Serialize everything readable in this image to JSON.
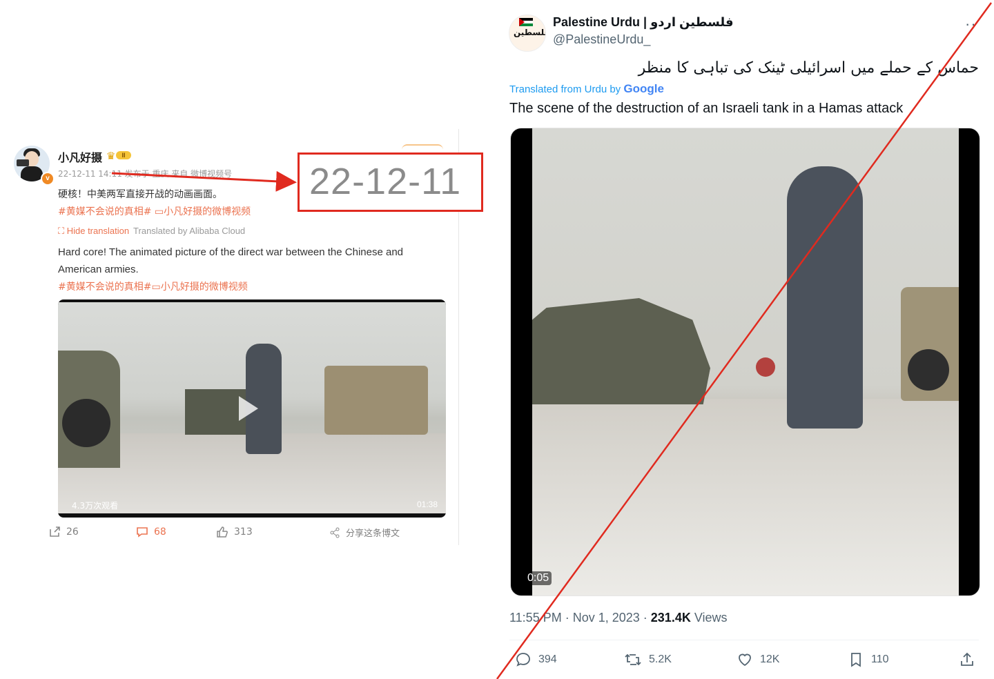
{
  "weibo": {
    "username": "小凡好摄",
    "level_badge": "II",
    "meta": "22-12-11 14:11 发布于 重庆 来自 微博视频号",
    "text": "硬核！中美两军直接开战的动画画面。",
    "tags": "#黄媒不会说的真相# ▭小凡好摄的微博视频",
    "hide_translation": "Hide translation",
    "translated_by": "Translated by Alibaba Cloud",
    "translated_text": "Hard core! The animated picture of the direct war between the Chinese and American armies.",
    "tags_translated": "#黄媒不会说的真相#▭小凡好摄的微博视频",
    "video": {
      "views": "4.3万次观看",
      "duration": "01:38"
    },
    "actions": {
      "repost": "26",
      "comments": "68",
      "likes": "313",
      "share": "分享这条博文"
    },
    "highlight_date": "22-12-11"
  },
  "tweet": {
    "display_name": "Palestine Urdu | فلسطین اردو",
    "handle": "@PalestineUrdu_",
    "more": "··",
    "urdu_text": "حماس کے حملے میں اسرائیلی ٹینک کی تباہی کا منظر",
    "translated_from": "Translated from Urdu by",
    "google": "Google",
    "text": "The scene of the destruction of an Israeli tank in a Hamas attack",
    "video_time": "0:05",
    "time": "11:55 PM · Nov 1, 2023 · ",
    "views_count": "231.4K",
    "views_label": " Views",
    "actions": {
      "replies": "394",
      "retweets": "5.2K",
      "likes": "12K",
      "bookmarks": "110"
    }
  },
  "colors": {
    "annotation_red": "#e02a1f",
    "weibo_orange": "#eb7350",
    "twitter_blue": "#1d9bf0"
  }
}
